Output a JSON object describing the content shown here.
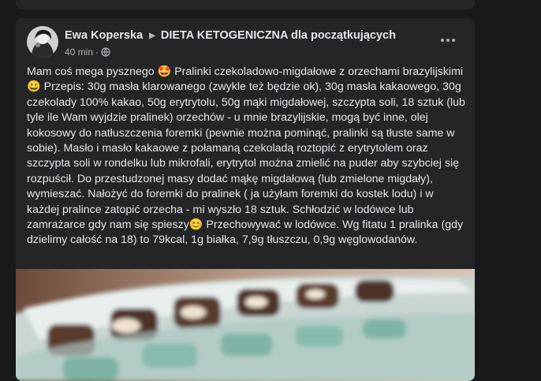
{
  "post": {
    "author": "Ewa Koperska",
    "group": "DIETA KETOGENICZNA dla początkujących",
    "time": "40 min",
    "separator": "·",
    "audience_icon": "globe-icon",
    "more_icon": "more-options-icon",
    "text": "Mam coś mega pysznego 🤩 Pralinki czekoladowo-migdałowe z orzechami brazylijskimi 😀 Przepis: 30g masła klarowanego (zwykle też będzie ok), 30g masła kakaowego, 30g czekolady 100% kakao, 50g erytrytolu, 50g mąki migdałowej, szczypta soli, 18 sztuk  (lub tyle ile Wam wyjdzie pralinek) orzechów - u mnie brazylijskie, mogą być inne, olej kokosowy do natłuszczenia foremki (pewnie można pominąć, pralinki są tłuste same w sobie). Masło i masło kakaowe z połamaną czekoladą roztopić z erytrytolem oraz szczypta soli w rondelku lub mikrofali, erytrytol można zmielić na puder aby szybciej się rozpuścił. Do przestudzonej masy dodać mąkę migdałową (lub zmielone migdały), wymieszać. Nałożyć do foremki do pralinek ( ja użyłam foremki do kostek lodu) i w każdej pralince zatopić orzecha - mi wyszło 18 sztuk. Schłodzić w lodówce lub zamrażarce gdy nam się spieszy😊  Przechowywać w lodówce. Wg fitatu 1 pralinka (gdy dzielimy całość na 18) to 79kcal, 1g białka, 7,9g tłuszczu, 0,9g węglowodanów."
  },
  "colors": {
    "page_bg": "#18191a",
    "card_bg": "#242526",
    "primary_text": "#e4e6eb",
    "secondary_text": "#b0b3b8"
  }
}
